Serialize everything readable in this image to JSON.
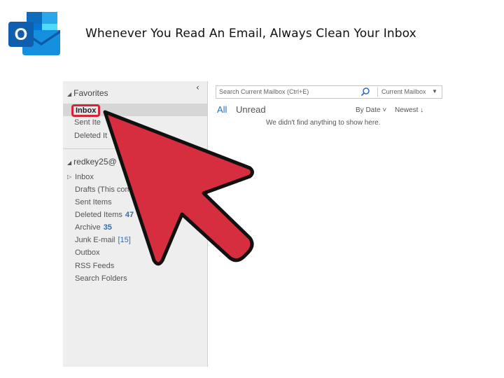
{
  "slide": {
    "title": "Whenever You Read An Email, Always Clean Your Inbox",
    "logo_letter": "O",
    "logo_icon": "outlook-icon"
  },
  "sidebar": {
    "collapse_glyph": "‹",
    "favorites_heading": "Favorites",
    "favorites": [
      {
        "label": "Inbox",
        "selected": true
      },
      {
        "label": "Sent Ite"
      },
      {
        "label": "Deleted It"
      }
    ],
    "account_heading": "redkey25@",
    "folders": [
      {
        "label": "Inbox",
        "count": ""
      },
      {
        "label": "Drafts (This com",
        "count": ""
      },
      {
        "label": "Sent Items",
        "count": ""
      },
      {
        "label": "Deleted Items",
        "count": "47"
      },
      {
        "label": "Archive",
        "count": "35"
      },
      {
        "label": "Junk E-mail",
        "count": "[15]"
      },
      {
        "label": "Outbox",
        "count": ""
      },
      {
        "label": "RSS Feeds",
        "count": ""
      },
      {
        "label": "Search Folders",
        "count": ""
      }
    ]
  },
  "search": {
    "placeholder": "Search Current Mailbox (Ctrl+E)",
    "scope": "Current Mailbox",
    "search_icon": "search-icon",
    "dropdown_glyph": "▼"
  },
  "list": {
    "tab_all": "All",
    "tab_unread": "Unread",
    "sort_by": "By Date ˅",
    "sort_order": "Newest ↓",
    "empty_message": "We didn't find anything to show here."
  },
  "colors": {
    "accent": "#2b70b5",
    "arrow_fill": "#d62e3e",
    "highlight": "#d4243a",
    "outlook_blue": "#0f6cbd"
  }
}
